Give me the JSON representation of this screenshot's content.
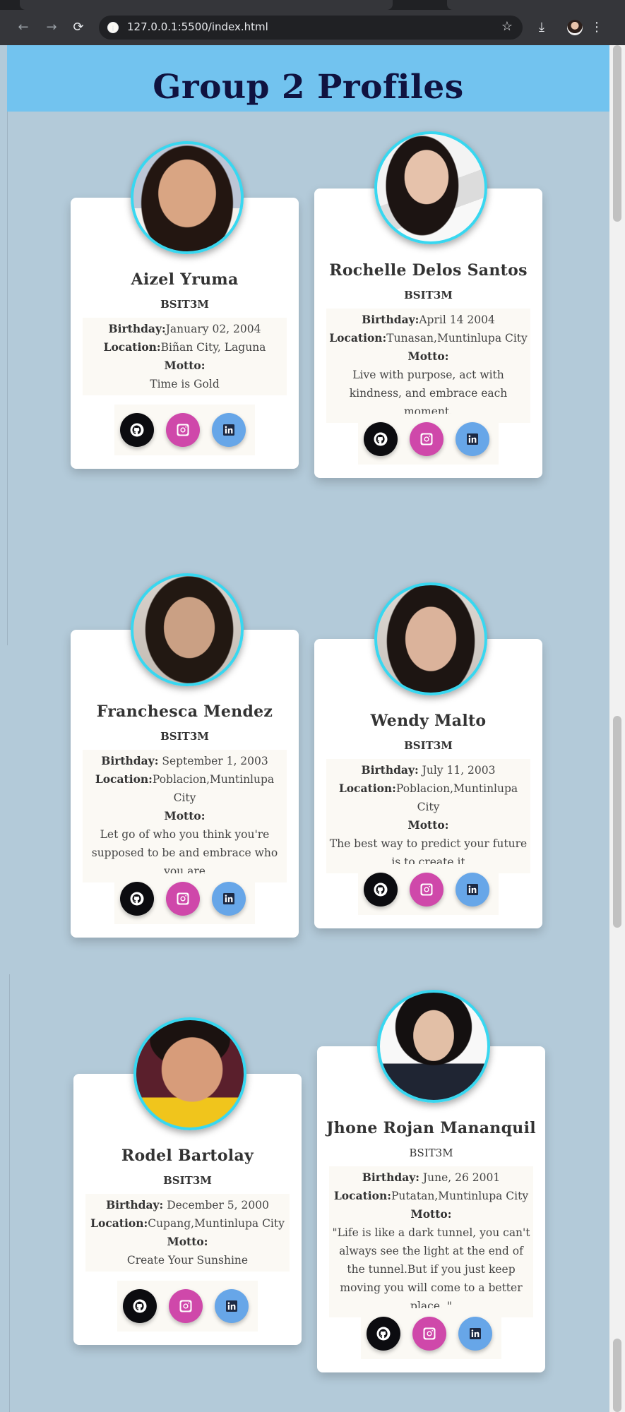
{
  "browser": {
    "url": "127.0.0.1:5500/index.html",
    "icons": {
      "back": "←",
      "forward": "→",
      "reload": "⟳",
      "star": "☆",
      "download": "⤓",
      "menu": "⋮"
    }
  },
  "header": {
    "title": "Group 2 Profiles"
  },
  "labels": {
    "birthday": "Birthday:",
    "location": "Location:",
    "motto": "Motto:"
  },
  "profiles": [
    {
      "name": "Aizel Yruma",
      "course": "BSIT3M",
      "birthday": "January 02, 2004",
      "location": "Biñan City, Laguna",
      "motto": "Time is Gold"
    },
    {
      "name": "Rochelle Delos Santos",
      "course": "BSIT3M",
      "birthday": "April 14 2004",
      "location": "Tunasan,Muntinlupa City",
      "motto": "Live with purpose, act with kindness, and embrace each moment."
    },
    {
      "name": "Franchesca Mendez",
      "course": "BSIT3M",
      "birthday": " September 1, 2003",
      "location": "Poblacion,Muntinlupa City",
      "motto": "Let go of who you think you're supposed to be and embrace who you are"
    },
    {
      "name": "Wendy Malto",
      "course": "BSIT3M",
      "birthday": " July 11, 2003",
      "location": "Poblacion,Muntinlupa City",
      "motto": "The best way to predict your future is to create it"
    },
    {
      "name": "Rodel Bartolay",
      "course": "BSIT3M",
      "birthday": " December 5, 2000",
      "location": "Cupang,Muntinlupa City",
      "motto": "Create Your Sunshine"
    },
    {
      "name": "Jhone Rojan Mananquil",
      "course": "BSIT3M",
      "birthday": " June, 26 2001",
      "location": "Putatan,Muntinlupa City",
      "motto": "\"Life is like a dark tunnel, you can't always see the light at the end of the tunnel.But if you just keep moving you will come to a better place. \""
    }
  ],
  "colors": {
    "header_bg": "#72c3ef",
    "page_bg": "#b3cad9",
    "photo_border": "#38d7f0",
    "github": "#0c0c10",
    "instagram": "#cf48aa",
    "linkedin": "#67a6e8"
  }
}
